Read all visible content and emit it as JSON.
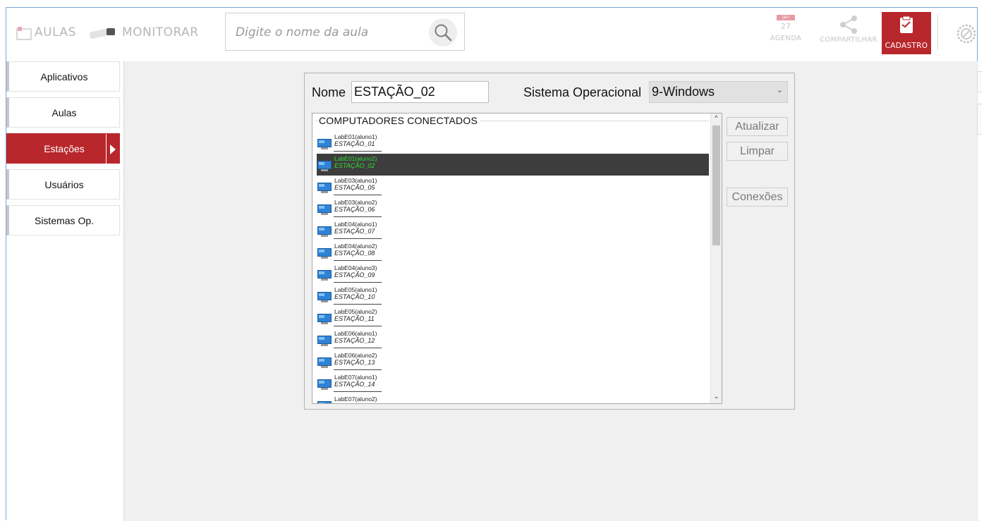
{
  "nav": {
    "aulas_label": "AULAS",
    "monitorar_label": "MONITORAR"
  },
  "search": {
    "placeholder": "Digite o nome da aula"
  },
  "toolbar": {
    "agenda": {
      "month": "jan",
      "day": "27",
      "label": "AGENDA"
    },
    "share_label": "COMPARTILHAR",
    "cadastro_label": "CADASTRO"
  },
  "sidebar": {
    "items": [
      {
        "label": "Aplicativos"
      },
      {
        "label": "Aulas"
      },
      {
        "label": "Estações",
        "active": true
      },
      {
        "label": "Usuários"
      },
      {
        "label": "Sistemas Op."
      }
    ]
  },
  "form": {
    "nome_label": "Nome",
    "nome_value": "ESTAÇÃO_02",
    "so_label": "Sistema Operacional",
    "so_value": "9-Windows"
  },
  "list": {
    "title": "COMPUTADORES CONECTADOS",
    "rows": [
      {
        "name": "LabE01(aluno1)",
        "station": "ESTAÇÃO_01"
      },
      {
        "name": "LabE01(aluno2)",
        "station": "ESTAÇÃO_02",
        "selected": true
      },
      {
        "name": "LabE03(aluno1)",
        "station": "ESTAÇÃO_05"
      },
      {
        "name": "LabE03(aluno2)",
        "station": "ESTAÇÃO_06"
      },
      {
        "name": "LabE04(aluno1)",
        "station": "ESTAÇÃO_07"
      },
      {
        "name": "LabE04(aluno2)",
        "station": "ESTAÇÃO_08"
      },
      {
        "name": "LabE04(aluno3)",
        "station": "ESTAÇÃO_09"
      },
      {
        "name": "LabE05(aluno1)",
        "station": "ESTAÇÃO_10"
      },
      {
        "name": "LabE05(aluno2)",
        "station": "ESTAÇÃO_11"
      },
      {
        "name": "LabE06(aluno1)",
        "station": "ESTAÇÃO_12"
      },
      {
        "name": "LabE06(aluno2)",
        "station": "ESTAÇÃO_13"
      },
      {
        "name": "LabE07(aluno1)",
        "station": "ESTAÇÃO_14"
      },
      {
        "name": "LabE07(aluno2)",
        "station": ""
      }
    ]
  },
  "buttons": {
    "atualizar": "Atualizar",
    "limpar": "Limpar",
    "conexoes": "Conexões"
  },
  "colors": {
    "accent": "#b8272c",
    "selected_row_bg": "#3d3d3d",
    "selected_row_text": "#33dd33"
  },
  "icons": [
    "aulas-icon",
    "camera-icon",
    "search-icon",
    "calendar-icon",
    "share-icon",
    "clipboard-icon",
    "gear-icon",
    "monitor-icon",
    "chevron-down-icon",
    "arrow-right-icon"
  ]
}
